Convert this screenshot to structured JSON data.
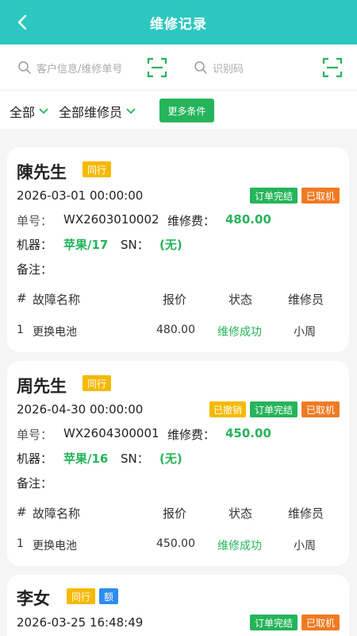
{
  "header": {
    "title": "维修记录"
  },
  "search": {
    "customer_placeholder": "客户信息/维修单号",
    "code_placeholder": "识别码"
  },
  "filters": {
    "all_label": "全部",
    "all_repairers_label": "全部维修员",
    "more_label": "更多条件"
  },
  "labels": {
    "order_no": "单号：",
    "repair_fee": "维修费：",
    "machine": "机器：",
    "sn": "SN：",
    "remark": "备注：",
    "col_index": "#",
    "col_fault": "故障名称",
    "col_price": "报价",
    "col_status": "状态",
    "col_repairer": "维修员"
  },
  "records": [
    {
      "customer": "陳先生",
      "customer_tags": [
        "同行"
      ],
      "datetime": "2026-03-01 00:00:00",
      "status_tags": [
        "订单完结",
        "已取机"
      ],
      "order_no": "WX2603010002",
      "fee": "480.00",
      "machine": "苹果/17",
      "sn": "(无)",
      "items": [
        {
          "index": "1",
          "fault": "更换电池",
          "price": "480.00",
          "status": "维修成功",
          "repairer": "小周"
        }
      ]
    },
    {
      "customer": "周先生",
      "customer_tags": [
        "同行"
      ],
      "datetime": "2026-04-30 00:00:00",
      "status_tags": [
        "已撤销",
        "订单完结",
        "已取机"
      ],
      "order_no": "WX2604300001",
      "fee": "450.00",
      "machine": "苹果/16",
      "sn": "(无)",
      "items": [
        {
          "index": "1",
          "fault": "更换电池",
          "price": "450.00",
          "status": "维修成功",
          "repairer": "小周"
        }
      ]
    },
    {
      "customer": "李女",
      "customer_tags": [
        "同行",
        "额"
      ],
      "datetime": "2026-03-25 16:48:49",
      "status_tags": [
        "订单完结",
        "已取机"
      ]
    }
  ],
  "colors": {
    "header_bg": "#2ec7bf",
    "accent_green": "#25b45a",
    "tag_yellow": "#f5b900",
    "tag_orange": "#f07a22",
    "tag_blue": "#2d8cf0"
  },
  "icons": [
    "back-arrow-icon",
    "search-icon",
    "scan-icon",
    "chevron-down-icon"
  ]
}
